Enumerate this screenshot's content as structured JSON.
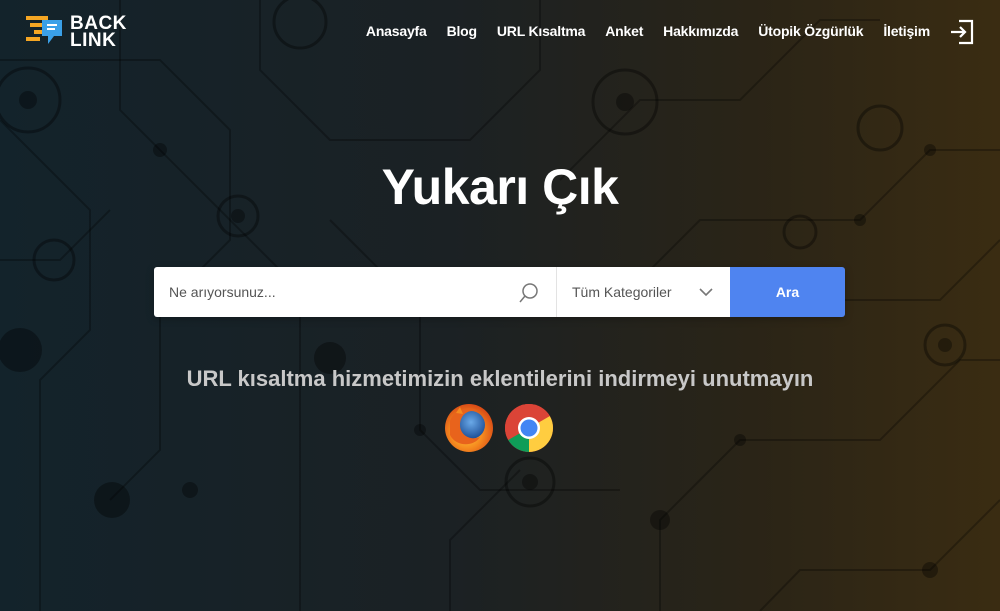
{
  "logo": {
    "line1": "BACK",
    "line2": "LINK"
  },
  "nav": {
    "items": [
      "Anasayfa",
      "Blog",
      "URL Kısaltma",
      "Anket",
      "Hakkımızda",
      "Ütopik Özgürlük",
      "İletişim"
    ],
    "login_icon": "login-icon"
  },
  "hero": {
    "title": "Yukarı Çık"
  },
  "search": {
    "placeholder": "Ne arıyorsunuz...",
    "category": "Tüm Kategoriler",
    "button": "Ara"
  },
  "extensions": {
    "text": "URL kısaltma hizmetimizin eklentilerini indirmeyi unutmayın",
    "icons": [
      "firefox-icon",
      "chrome-icon"
    ]
  },
  "colors": {
    "accent": "#4f84f0",
    "logo_orange": "#f5a623",
    "logo_blue": "#3aa0e8"
  }
}
